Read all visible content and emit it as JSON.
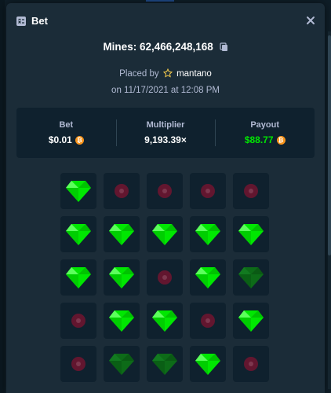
{
  "modal": {
    "title": "Bet",
    "icons": {
      "title": "bet-slip-icon",
      "close": "close-icon"
    }
  },
  "bet": {
    "mines_label": "Mines: 62,466,248,168",
    "placed_by_prefix": "Placed by",
    "username": "mantano",
    "date": "on 11/17/2021 at 12:08 PM"
  },
  "stats": {
    "bet_label": "Bet",
    "bet_value": "$0.01",
    "multiplier_label": "Multiplier",
    "multiplier_value": "9,193.39×",
    "payout_label": "Payout",
    "payout_value": "$88.77",
    "currency": "BTC"
  },
  "grid": {
    "rows": 5,
    "cols": 5,
    "tiles": [
      "gem",
      "mine",
      "mine",
      "mine",
      "mine",
      "gem",
      "gem",
      "gem",
      "gem",
      "gem",
      "gem",
      "gem",
      "mine",
      "gem",
      "gem-dim",
      "mine",
      "gem",
      "gem",
      "mine",
      "gem",
      "mine",
      "gem-dim",
      "gem-dim",
      "gem",
      "mine"
    ]
  },
  "colors": {
    "background": "#0f1e28",
    "modal_background": "#1b2c38",
    "panel": "#0f212e",
    "gem": "#00e701",
    "mine": "#6b1530",
    "payout": "#00e701",
    "coin": "#f7931a"
  }
}
